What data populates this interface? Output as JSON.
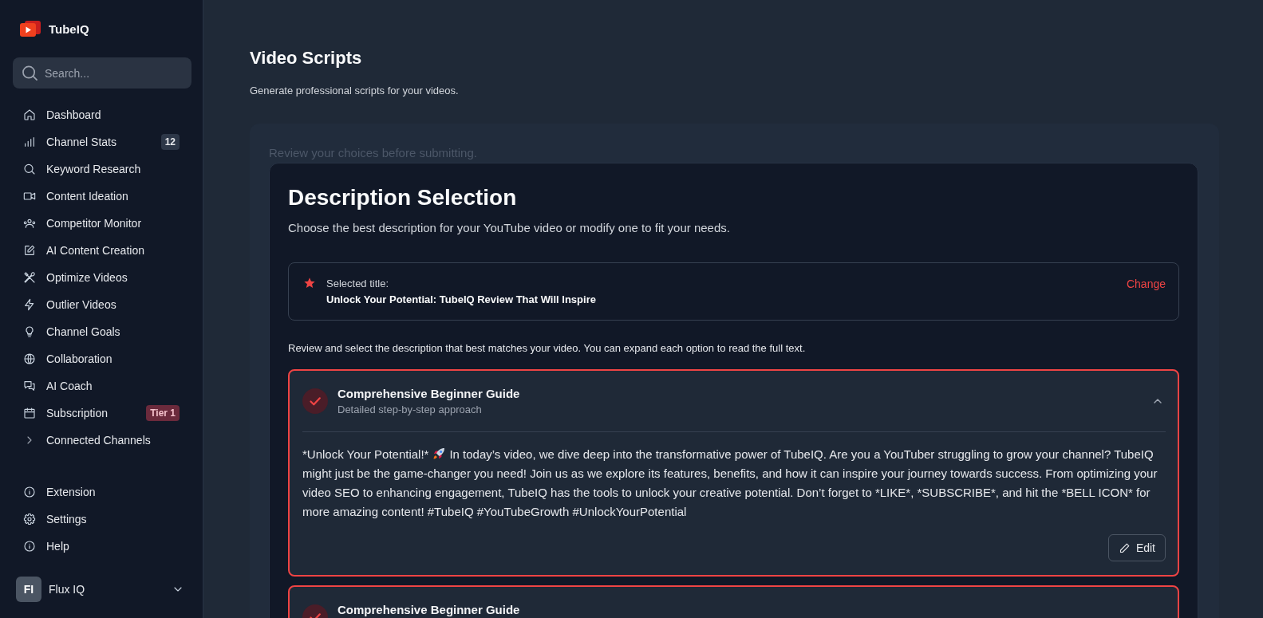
{
  "brand": {
    "name": "TubeIQ"
  },
  "sidebar": {
    "search": {
      "placeholder": "Search..."
    },
    "items": [
      {
        "label": "Dashboard",
        "selected": false
      },
      {
        "label": "Channel Stats",
        "selected": false,
        "badge": {
          "text": "12",
          "kind": "count"
        }
      },
      {
        "label": "Keyword Research",
        "selected": false
      },
      {
        "label": "Content Ideation",
        "selected": false
      },
      {
        "label": "Competitor Monitor",
        "selected": false
      },
      {
        "label": "AI Content Creation",
        "selected": false
      },
      {
        "label": "Optimize Videos",
        "selected": false
      },
      {
        "label": "Outlier Videos",
        "selected": false
      },
      {
        "label": "Channel Goals",
        "selected": false
      },
      {
        "label": "Collaboration",
        "selected": false
      },
      {
        "label": "AI Coach",
        "selected": false
      },
      {
        "label": "Subscription",
        "selected": false,
        "badge": {
          "text": "Tier 1",
          "kind": "tier"
        }
      },
      {
        "label": "Connected Channels",
        "selected": false,
        "expanded": false
      }
    ],
    "footer_items": [
      {
        "label": "Extension",
        "selected": false
      },
      {
        "label": "Settings",
        "selected": false
      },
      {
        "label": "Help",
        "selected": false
      }
    ],
    "user": {
      "initials": "FI",
      "name": "Flux IQ"
    }
  },
  "page": {
    "title": "Video Scripts",
    "subtitle": "Generate professional scripts for your videos."
  },
  "step": {
    "note": "Review your choices before submitting.",
    "title": "Description Selection",
    "subtitle": "Choose the best description for your YouTube video or modify one to fit your needs.",
    "selected_title": {
      "label": "Selected title:",
      "value": "Unlock Your Potential: TubeIQ Review That Will Inspire",
      "action": "Change"
    },
    "instruction": "Review and select the description that best matches your video. You can expand each option to read the full text.",
    "options": [
      {
        "title": "Comprehensive Beginner Guide",
        "subtitle": "Detailed step-by-step approach",
        "selected": true,
        "expanded": true,
        "body_lead": "*Unlock Your Potential!*",
        "body": "In today’s video, we dive deep into the transformative power of TubeIQ. Are you a YouTuber struggling to grow your channel? TubeIQ might just be the game-changer you need! Join us as we explore its features, benefits, and how it can inspire your journey towards success. From optimizing your video SEO to enhancing engagement, TubeIQ has the tools to unlock your creative potential. Don’t forget to *LIKE*, *SUBSCRIBE*, and hit the *BELL ICON* for more amazing content! #TubeIQ #YouTubeGrowth #UnlockYourPotential",
        "edit": "Edit"
      },
      {
        "title": "Comprehensive Beginner Guide",
        "selected": true
      }
    ]
  }
}
